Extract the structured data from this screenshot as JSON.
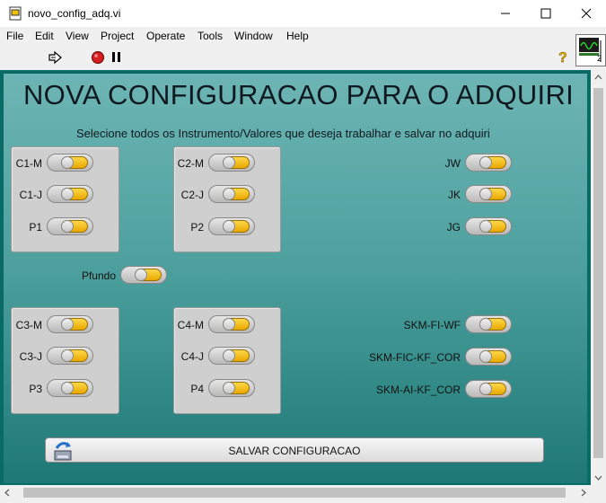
{
  "window": {
    "title": "novo_config_adq.vi"
  },
  "menu": [
    "File",
    "Edit",
    "View",
    "Project",
    "Operate",
    "Tools",
    "Window",
    "Help"
  ],
  "header": {
    "title": "NOVA CONFIGURACAO PARA O ADQUIRI",
    "subtitle": "Selecione todos os Instrumento/Valores que deseja trabalhar e salvar no adquiri"
  },
  "controls": {
    "c1m": "C1-M",
    "c1j": "C1-J",
    "p1": "P1",
    "c2m": "C2-M",
    "c2j": "C2-J",
    "p2": "P2",
    "jw": "JW",
    "jk": "JK",
    "jg": "JG",
    "pfundo": "Pfundo",
    "c3m": "C3-M",
    "c3j": "C3-J",
    "p3": "P3",
    "c4m": "C4-M",
    "c4j": "C4-J",
    "p4": "P4",
    "skm_fi_wf": "SKM-FI-WF",
    "skm_fic_kf_cor": "SKM-FIC-KF_COR",
    "skm_ai_kf_cor": "SKM-AI-KF_COR"
  },
  "save_button": {
    "label": "SALVAR CONFIGURACAO"
  },
  "icons": {
    "connector_pane_number": "2"
  },
  "colors": {
    "panel_top": "#6db5b4",
    "panel_bottom": "#1d7775",
    "lamp_on": "#f5c320"
  }
}
